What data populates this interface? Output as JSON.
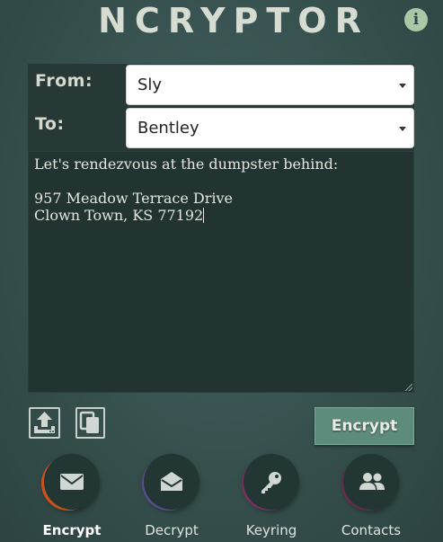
{
  "app": {
    "title": "NCRYPTOR"
  },
  "header": {
    "info_icon": "info-icon",
    "info_glyph": "i"
  },
  "form": {
    "from_label": "From:",
    "from_value": "Sly",
    "to_label": "To:",
    "to_value": "Bentley"
  },
  "message": {
    "text": "Let's rendezvous at the dumpster behind:\n\n957 Meadow Terrace Drive\nClown Town, KS 77192"
  },
  "toolbar": {
    "upload_icon": "upload-icon",
    "copy_icon": "copy-icon",
    "encrypt_label": "Encrypt"
  },
  "nav": {
    "items": [
      {
        "label": "Encrypt",
        "icon": "envelope-closed-icon",
        "active": true,
        "ring": "#c8521d"
      },
      {
        "label": "Decrypt",
        "icon": "envelope-open-icon",
        "active": false,
        "ring": "#5a4d8a"
      },
      {
        "label": "Keyring",
        "icon": "key-icon",
        "active": false,
        "ring": "#7a2f5e"
      },
      {
        "label": "Contacts",
        "icon": "contacts-icon",
        "active": false,
        "ring": "#6a2a50"
      }
    ]
  }
}
